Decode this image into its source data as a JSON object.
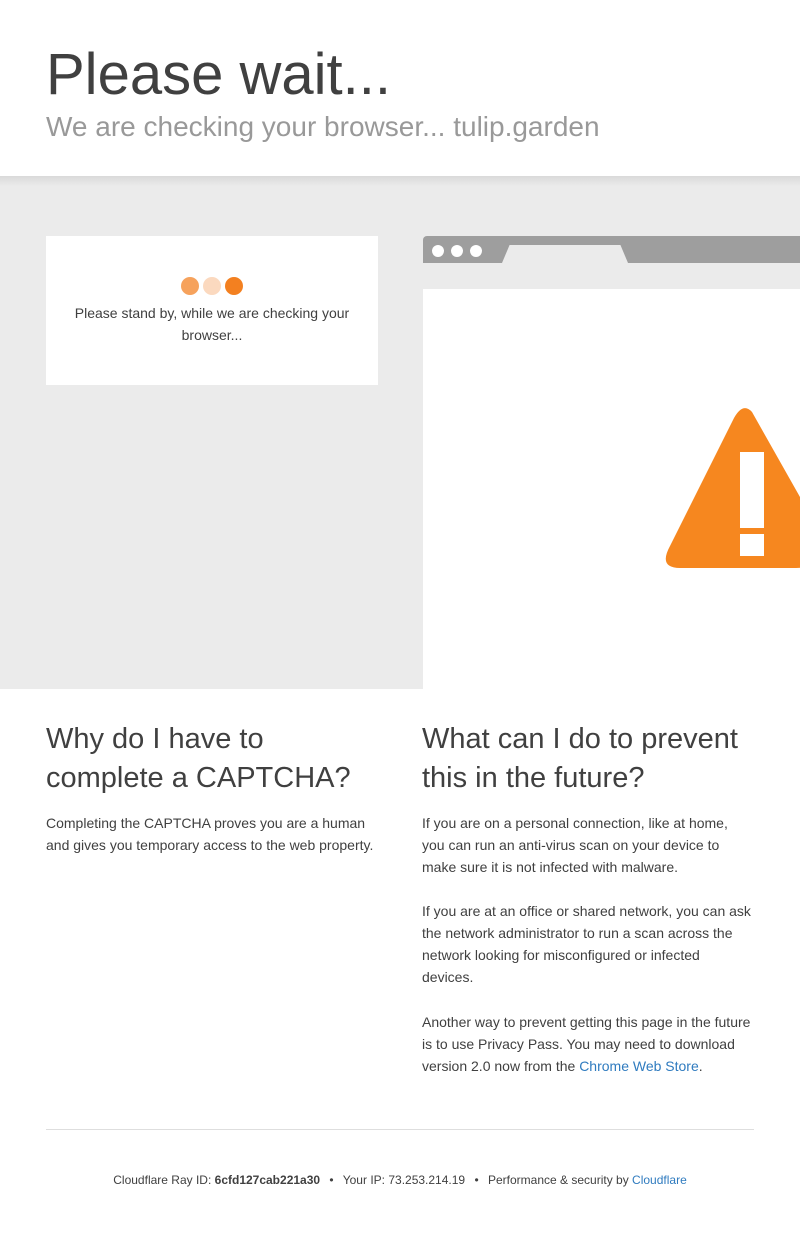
{
  "header": {
    "title": "Please wait...",
    "subtitle": "We are checking your browser... tulip.garden"
  },
  "standby": {
    "text": "Please stand by, while we are checking your browser...",
    "dot_colors": [
      "#f6a25c",
      "#fbd9bf",
      "#f38020"
    ]
  },
  "illustration": {
    "icon": "warning-icon",
    "warning_color": "#f6871f"
  },
  "why": {
    "heading": "Why do I have to complete a CAPTCHA?",
    "body": "Completing the CAPTCHA proves you are a human and gives you temporary access to the web property."
  },
  "prevent": {
    "heading": "What can I do to prevent this in the future?",
    "para1": "If you are on a personal connection, like at home, you can run an anti-virus scan on your device to make sure it is not infected with malware.",
    "para2": "If you are at an office or shared network, you can ask the network administrator to run a scan across the network looking for misconfigured or infected devices.",
    "para3_prefix": "Another way to prevent getting this page in the future is to use Privacy Pass. You may need to download version 2.0 now from the ",
    "para3_link": "Chrome Web Store",
    "para3_suffix": "."
  },
  "footer": {
    "ray_label": "Cloudflare Ray ID:",
    "ray_id": "6cfd127cab221a30",
    "separator": "•",
    "ip_label": "Your IP:",
    "ip": "73.253.214.19",
    "perf_label": "Performance & security by",
    "perf_link": "Cloudflare"
  },
  "colors": {
    "link": "#2f7bbf",
    "background_gray": "#ebebeb"
  }
}
